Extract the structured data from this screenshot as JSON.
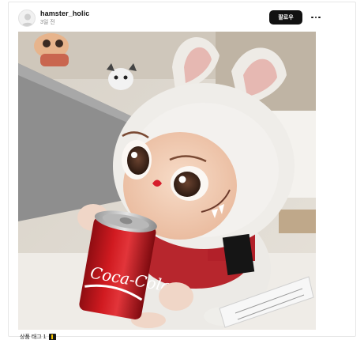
{
  "post": {
    "username": "hamster_holic",
    "time": "3일 전",
    "follow_label": "팔로우",
    "more_icon": "more-dots-icon",
    "photo_can_text": "Coca-Cola",
    "tag_label": "상품 태그 1",
    "tag_icon": "product-tag-icon"
  },
  "colors": {
    "follow_bg": "#111111",
    "can_red": "#c3161c"
  }
}
